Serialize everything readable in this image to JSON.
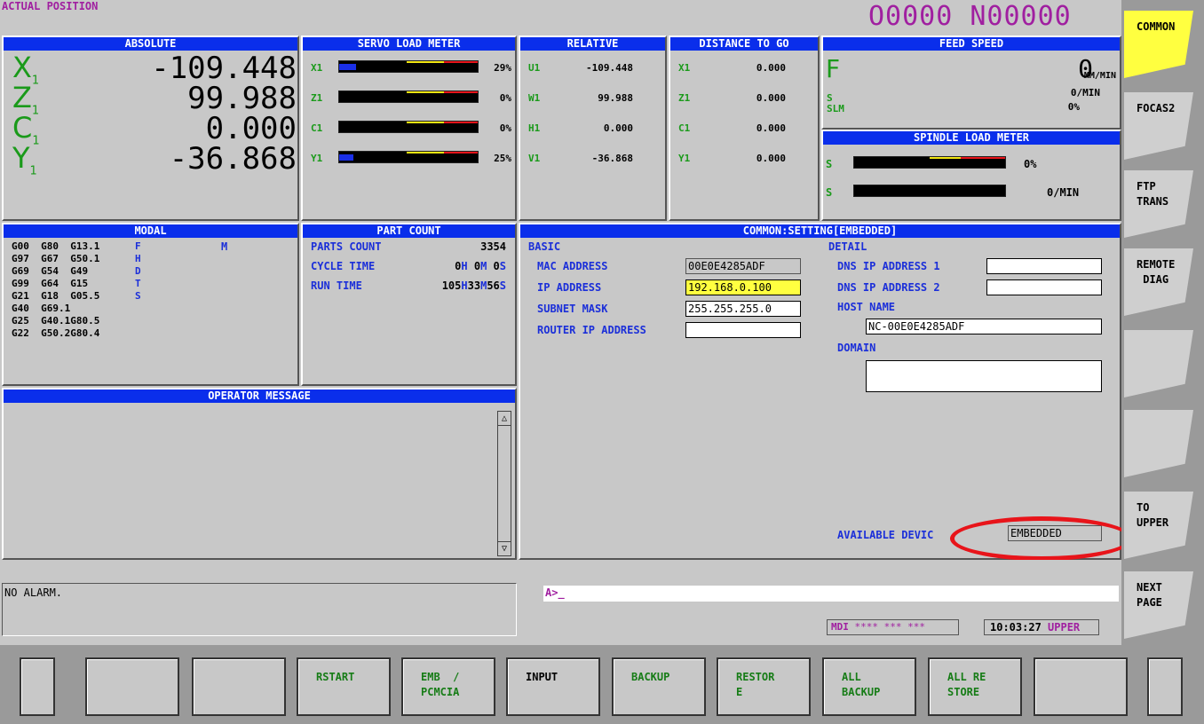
{
  "top": {
    "screen_title": "ACTUAL POSITION",
    "program_number": "O0000 N00000"
  },
  "absolute": {
    "title": "ABSOLUTE",
    "axes": [
      {
        "name": "X",
        "sub": "1",
        "value": "-109.448"
      },
      {
        "name": "Z",
        "sub": "1",
        "value": "99.988"
      },
      {
        "name": "C",
        "sub": "1",
        "value": "0.000"
      },
      {
        "name": "Y",
        "sub": "1",
        "value": "-36.868"
      }
    ]
  },
  "servo": {
    "title": "SERVO LOAD METER",
    "rows": [
      {
        "axis": "X1",
        "percent": "29%",
        "level": 0.12
      },
      {
        "axis": "Z1",
        "percent": "0%",
        "level": 0.0
      },
      {
        "axis": "C1",
        "percent": "0%",
        "level": 0.0
      },
      {
        "axis": "Y1",
        "percent": "25%",
        "level": 0.1
      }
    ]
  },
  "relative": {
    "title": "RELATIVE",
    "rows": [
      {
        "axis": "U1",
        "value": "-109.448"
      },
      {
        "axis": "W1",
        "value": "99.988"
      },
      {
        "axis": "H1",
        "value": "0.000"
      },
      {
        "axis": "V1",
        "value": "-36.868"
      }
    ]
  },
  "distance": {
    "title": "DISTANCE TO GO",
    "rows": [
      {
        "axis": "X1",
        "value": "0.000"
      },
      {
        "axis": "Z1",
        "value": "0.000"
      },
      {
        "axis": "C1",
        "value": "0.000"
      },
      {
        "axis": "Y1",
        "value": "0.000"
      }
    ]
  },
  "feed": {
    "title": "FEED SPEED",
    "f_label": "F",
    "f_value": "0",
    "f_unit": "MM/MIN",
    "s_label": "S",
    "slm_label": "SLM",
    "s_value": "0/MIN",
    "slm_value": "0%"
  },
  "spindle": {
    "title": "SPINDLE LOAD METER",
    "rows": [
      {
        "label": "S",
        "value": "0%"
      },
      {
        "label": "S",
        "value": "0/MIN"
      }
    ]
  },
  "modal": {
    "title": "MODAL",
    "lines": [
      "G00  G80  G13.1",
      "G97  G67  G50.1",
      "G69  G54  G49",
      "G99  G64  G15",
      "G21  G18  G05.5",
      "G40  G69.1",
      "G25  G40.1G80.5",
      "G22  G50.2G80.4"
    ],
    "letters": [
      "F",
      "H",
      "D",
      "T",
      "S"
    ],
    "m_label": "M"
  },
  "partcount": {
    "title": "PART COUNT",
    "parts_label": "PARTS COUNT",
    "parts_value": "3354",
    "cycle_label": "CYCLE TIME",
    "cycle": {
      "h": "0",
      "m": "0",
      "s": "0"
    },
    "run_label": "RUN TIME",
    "run": {
      "h": "105",
      "m": "33",
      "s": "56"
    },
    "units": {
      "h": "H",
      "m": "M",
      "s": "S"
    }
  },
  "setting": {
    "title": "COMMON:SETTING[EMBEDDED]",
    "basic_label": "BASIC",
    "detail_label": "DETAIL",
    "mac_label": "MAC ADDRESS",
    "mac_value": "00E0E4285ADF",
    "ip_label": "IP ADDRESS",
    "ip_value": "192.168.0.100",
    "subnet_label": "SUBNET MASK",
    "subnet_value": "255.255.255.0",
    "router_label": "ROUTER IP ADDRESS",
    "router_value": "",
    "dns1_label": "DNS IP ADDRESS 1",
    "dns1_value": "",
    "dns2_label": "DNS IP ADDRESS 2",
    "dns2_value": "",
    "host_label": "HOST NAME",
    "host_value": "NC-00E0E4285ADF",
    "domain_label": "DOMAIN",
    "domain_value": "",
    "device_label": "AVAILABLE DEVIC",
    "device_value": "EMBEDDED"
  },
  "operator": {
    "title": "OPERATOR MESSAGE"
  },
  "status": {
    "alarm": "NO ALARM.",
    "prompt": "A>_",
    "mode": "MDI",
    "stars": "**** *** ***",
    "time": "10:03:27",
    "upper": "UPPER"
  },
  "side_keys": [
    "COMMON",
    "FOCAS2",
    "FTP\nTRANS",
    "REMOTE\n DIAG",
    "",
    "",
    "TO\nUPPER",
    "NEXT\nPAGE"
  ],
  "soft_keys": [
    "",
    "",
    "",
    "RSTART",
    "EMB  /\nPCMCIA",
    "INPUT",
    "BACKUP",
    "RESTOR\nE",
    "ALL\nBACKUP",
    "ALL RE\nSTORE",
    "",
    ""
  ],
  "colors": {
    "header": "#0a2eeb",
    "axis_green": "#1a9a1a",
    "label_blue": "#1b2fd9",
    "purple": "#a01fa0",
    "highlight": "#ffff40",
    "annotation_red": "#e8141a"
  }
}
